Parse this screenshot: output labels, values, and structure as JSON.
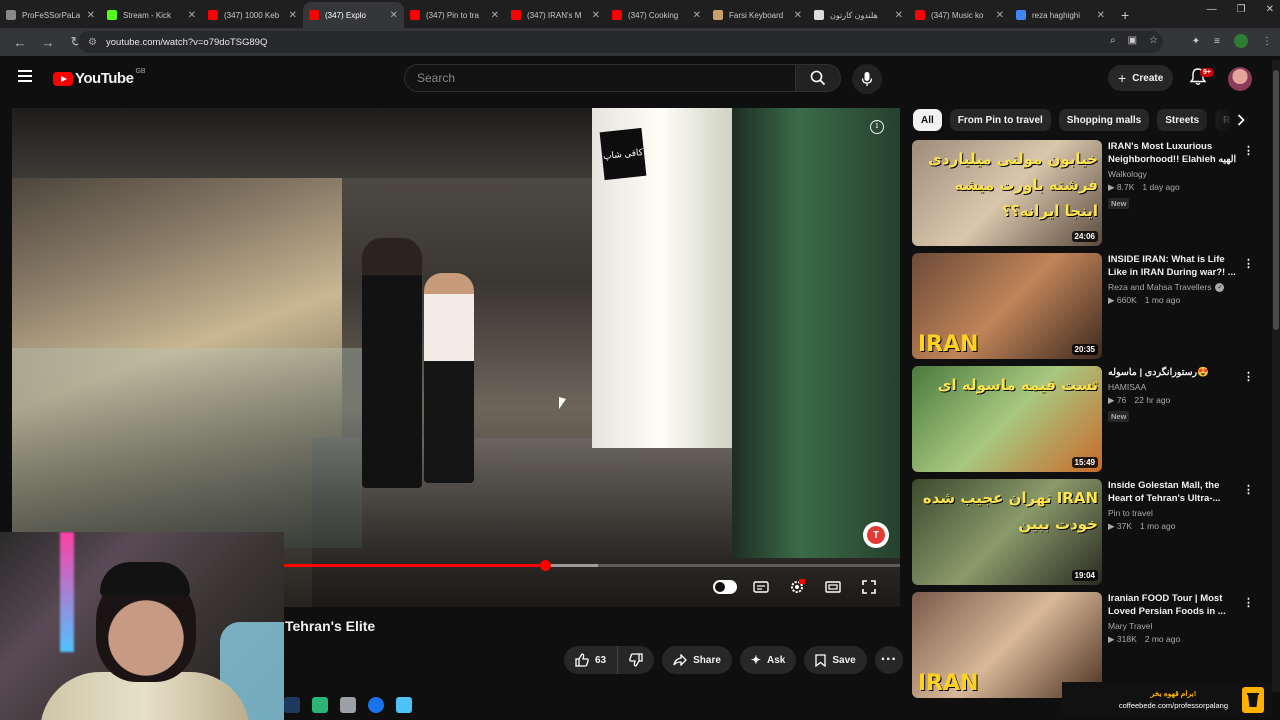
{
  "browser": {
    "tabs": [
      {
        "title": "ProFeSSorPaLa",
        "color": "#888888",
        "active": false
      },
      {
        "title": "Stream - Kick",
        "color": "#53fc18",
        "active": false
      },
      {
        "title": "(347) 1000 Keb",
        "color": "#ff0000",
        "active": false
      },
      {
        "title": "(347) Explo",
        "color": "#ff0000",
        "active": true
      },
      {
        "title": "(347) Pin to tra",
        "color": "#ff0000",
        "active": false
      },
      {
        "title": "(347) IRAN's M",
        "color": "#ff0000",
        "active": false
      },
      {
        "title": "(347) Cooking",
        "color": "#ff0000",
        "active": false
      },
      {
        "title": "Farsi Keyboard",
        "color": "#c9a06a",
        "active": false
      },
      {
        "title": "هلندون کارتون",
        "color": "#dddddd",
        "active": false
      },
      {
        "title": "(347) Music ko",
        "color": "#ff0000",
        "active": false
      },
      {
        "title": "reza haghighi",
        "color": "#4285f4",
        "active": false
      }
    ],
    "new_tab": "+",
    "url": "youtube.com/watch?v=o79doTSG89Q"
  },
  "masthead": {
    "logo_text": "YouTube",
    "country_code": "GB",
    "search_placeholder": "Search",
    "create_label": "Create",
    "notification_count": "9+"
  },
  "player": {
    "progress_played_fraction": 0.6,
    "progress_buffered_fraction": 0.66,
    "watermark_letter": "T",
    "sign_text": "کافی شاپ"
  },
  "video": {
    "title": "Tehran's Elite",
    "like_count": "63",
    "share_label": "Share",
    "ask_label": "Ask",
    "save_label": "Save"
  },
  "chips": [
    "All",
    "From Pin to travel",
    "Shopping malls",
    "Streets",
    "R"
  ],
  "recommendations": [
    {
      "title": "IRAN's Most Luxurious Neighborhood!! Elahieh الهیه",
      "channel": "Walkology",
      "verified": false,
      "views": "8.7K",
      "age": "1 day ago",
      "duration": "24:06",
      "is_new": true,
      "new_label": "New",
      "thumb_text": "خیابون مولتی میلیاردی فرشته باورت میشه اینجا ایرانه؟؟",
      "colors": [
        "#9e8b7a",
        "#d9c7ad",
        "#5a4a3e"
      ]
    },
    {
      "title": "INSIDE IRAN: What is Life Like in IRAN During war?! ...",
      "channel": "Reza and Mahsa Travellers",
      "verified": true,
      "views": "660K",
      "age": "1 mo ago",
      "duration": "20:35",
      "is_new": false,
      "thumb_text": "IRAN",
      "colors": [
        "#6b4a38",
        "#c08458",
        "#3d2a20"
      ]
    },
    {
      "title": "رستورانگردی | ماسوله😍",
      "channel": "HAMISAA",
      "verified": false,
      "views": "76",
      "age": "22 hr ago",
      "duration": "15:49",
      "is_new": true,
      "new_label": "New",
      "thumb_text": "تست قیمه ماسوله ای",
      "colors": [
        "#4a7a3c",
        "#a8c880",
        "#c86a2a"
      ]
    },
    {
      "title": "Inside Golestan Mall, the Heart of Tehran's Ultra-...",
      "channel": "Pin to travel",
      "verified": false,
      "views": "37K",
      "age": "1 mo ago",
      "duration": "19:04",
      "is_new": false,
      "thumb_text": "IRAN تهران عجیب شده خودت ببین",
      "colors": [
        "#3a4a2e",
        "#8a9a6a",
        "#2a2a22"
      ]
    },
    {
      "title": "Iranian FOOD Tour | Most Loved Persian Foods in ...",
      "channel": "Mary Travel",
      "verified": false,
      "views": "318K",
      "age": "2 mo ago",
      "duration": "",
      "is_new": false,
      "thumb_text": "IRAN",
      "colors": [
        "#7a5a4a",
        "#d8b898",
        "#4a3020"
      ]
    }
  ],
  "overlay": {
    "line1": "برام قهوه بخر!",
    "line2": "coffeebede.com/professorpalang"
  },
  "theme": {
    "accent": "#ff0000",
    "bg": "#0f0f0f"
  }
}
